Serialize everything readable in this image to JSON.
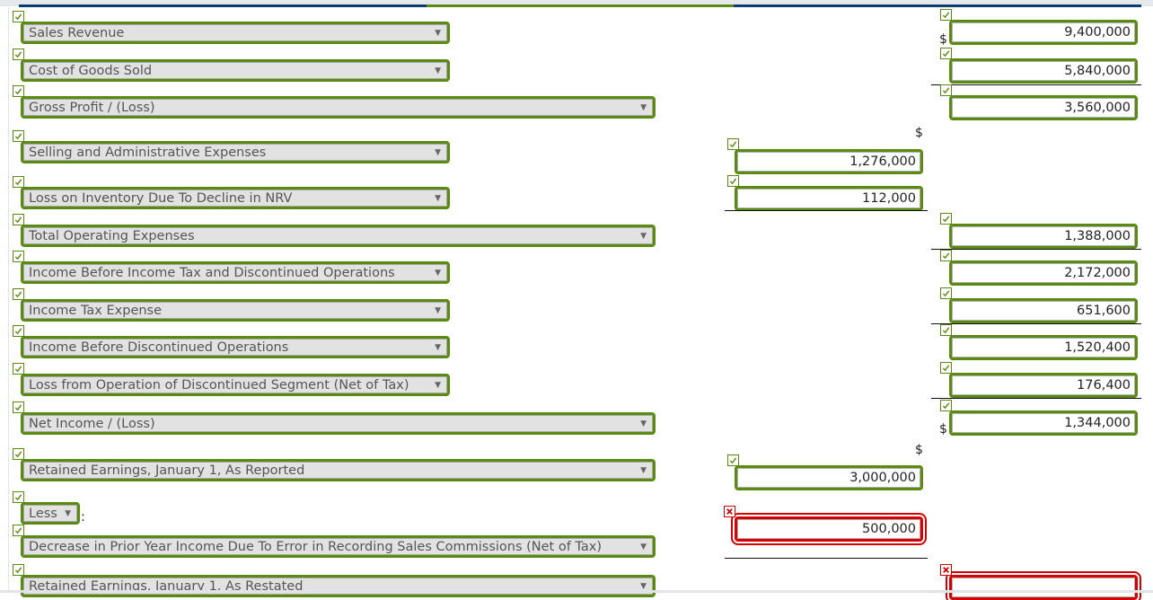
{
  "statement": {
    "rows": [
      {
        "label": "Sales Revenue",
        "status": "correct",
        "right_value": "9,400,000",
        "right_status": "correct",
        "right_dollar": "$"
      },
      {
        "label": "Cost of Goods Sold",
        "status": "correct",
        "right_value": "5,840,000",
        "right_status": "correct"
      },
      {
        "label": "Gross Profit / (Loss)",
        "status": "correct",
        "right_value": "3,560,000",
        "right_status": "correct"
      },
      {
        "label": "Selling and Administrative Expenses",
        "status": "correct",
        "mid_value": "1,276,000",
        "mid_status": "correct",
        "mid_dollar": "$"
      },
      {
        "label": "Loss on Inventory Due To Decline in NRV",
        "status": "correct",
        "mid_value": "112,000",
        "mid_status": "correct"
      },
      {
        "label": "Total Operating Expenses",
        "status": "correct",
        "right_value": "1,388,000",
        "right_status": "correct"
      },
      {
        "label": "Income Before Income Tax and Discontinued Operations",
        "status": "correct",
        "right_value": "2,172,000",
        "right_status": "correct"
      },
      {
        "label": "Income Tax Expense",
        "status": "correct",
        "right_value": "651,600",
        "right_status": "correct"
      },
      {
        "label": "Income Before Discontinued Operations",
        "status": "correct",
        "right_value": "1,520,400",
        "right_status": "correct"
      },
      {
        "label": "Loss from Operation of Discontinued Segment (Net of Tax)",
        "status": "correct",
        "right_value": "176,400",
        "right_status": "correct"
      },
      {
        "label": "Net Income / (Loss)",
        "status": "correct",
        "right_value": "1,344,000",
        "right_status": "correct",
        "right_dollar": "$"
      },
      {
        "label": "Retained Earnings, January 1, As Reported",
        "status": "correct",
        "mid_value": "3,000,000",
        "mid_status": "correct",
        "mid_dollar": "$"
      },
      {
        "label": "Less",
        "status": "correct",
        "suffix": ":"
      },
      {
        "label": "Decrease in Prior Year Income Due To Error in Recording Sales Commissions (Net of Tax)",
        "status": "correct",
        "mid_value": "500,000",
        "mid_status": "incorrect"
      },
      {
        "label": "Retained Earnings, January 1, As Restated",
        "status": "correct",
        "right_value": "",
        "right_status": "incorrect"
      }
    ]
  },
  "icons": {
    "dropdown_arrow": "▼"
  },
  "colors": {
    "correct": "#5b8a12",
    "incorrect": "#d60000",
    "select_bg": "#e2e2e2"
  }
}
